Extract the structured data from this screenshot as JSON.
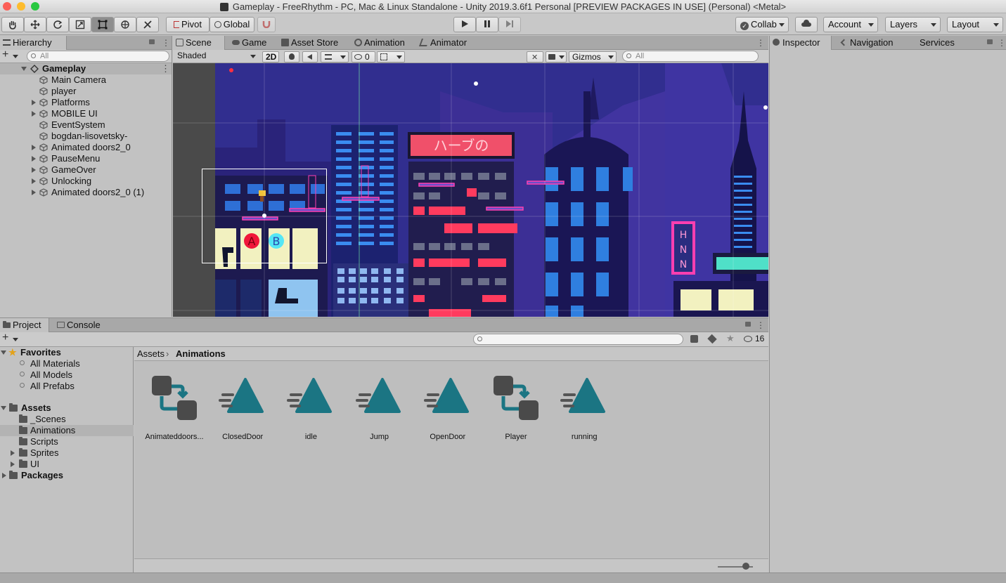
{
  "window": {
    "title": "Gameplay - FreeRhythm - PC, Mac & Linux Standalone - Unity 2019.3.6f1 Personal [PREVIEW PACKAGES IN USE] (Personal) <Metal>"
  },
  "colors": {
    "close": "#fc5f57",
    "minimize": "#fdbc2e",
    "maximize": "#28c840",
    "selection": "#b3b3b3",
    "asset_teal": "#1b7583",
    "scene_sky": "#2a2a7e"
  },
  "toolbar": {
    "tools": [
      "hand-icon",
      "move-icon",
      "rotate-icon",
      "scale-icon",
      "rect-icon",
      "transform-icon",
      "custom-tool-icon"
    ],
    "pivot": "Pivot",
    "global": "Global",
    "collab": "Collab",
    "account": "Account",
    "layers": "Layers",
    "layout": "Layout"
  },
  "hierarchy": {
    "tab": "Hierarchy",
    "search_placeholder": "All",
    "scene": "Gameplay",
    "items": [
      {
        "label": "Main Camera",
        "expandable": false
      },
      {
        "label": "player",
        "expandable": false
      },
      {
        "label": "Platforms",
        "expandable": true
      },
      {
        "label": "MOBILE UI",
        "expandable": true
      },
      {
        "label": "EventSystem",
        "expandable": false
      },
      {
        "label": "bogdan-lisovetsky-",
        "expandable": false
      },
      {
        "label": "Animated doors2_0",
        "expandable": true
      },
      {
        "label": "PauseMenu",
        "expandable": true
      },
      {
        "label": "GameOver",
        "expandable": true
      },
      {
        "label": "Unlocking",
        "expandable": true
      },
      {
        "label": "Animated doors2_0 (1)",
        "expandable": true
      }
    ]
  },
  "scene_view": {
    "tabs": [
      "Scene",
      "Game",
      "Asset Store",
      "Animation",
      "Animator"
    ],
    "shading": "Shaded",
    "mode_2d": "2D",
    "hidden_count": "0",
    "gizmos": "Gizmos",
    "search_placeholder": "All",
    "neon_sign": "ハーブの",
    "buttons": {
      "a": "A",
      "b": "B"
    },
    "vertical_sign": "HNN"
  },
  "inspector": {
    "tabs": [
      "Inspector",
      "Navigation",
      "Services"
    ]
  },
  "project": {
    "tabs": [
      "Project",
      "Console"
    ],
    "hidden_count": "16",
    "favorites_label": "Favorites",
    "favorites": [
      "All Materials",
      "All Models",
      "All Prefabs"
    ],
    "assets_label": "Assets",
    "folders": [
      {
        "label": "_Scenes",
        "expandable": false,
        "selected": false
      },
      {
        "label": "Animations",
        "expandable": false,
        "selected": true
      },
      {
        "label": "Scripts",
        "expandable": false,
        "selected": false
      },
      {
        "label": "Sprites",
        "expandable": true,
        "selected": false
      },
      {
        "label": "UI",
        "expandable": true,
        "selected": false
      }
    ],
    "packages_label": "Packages",
    "breadcrumb": [
      "Assets",
      "Animations"
    ],
    "assets": [
      {
        "label": "Animateddoors...",
        "icon": "animator-controller-icon"
      },
      {
        "label": "ClosedDoor",
        "icon": "animation-clip-icon"
      },
      {
        "label": "idle",
        "icon": "animation-clip-icon"
      },
      {
        "label": "Jump",
        "icon": "animation-clip-icon"
      },
      {
        "label": "OpenDoor",
        "icon": "animation-clip-icon"
      },
      {
        "label": "Player",
        "icon": "animator-controller-icon"
      },
      {
        "label": "running",
        "icon": "animation-clip-icon"
      }
    ],
    "zoom": 0.8
  }
}
